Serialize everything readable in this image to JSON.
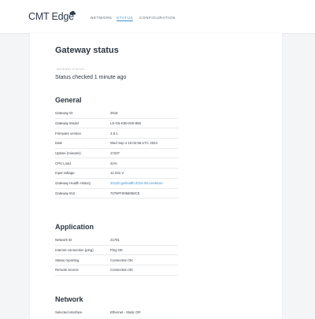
{
  "header": {
    "brand": "CMT Edge",
    "brand_icon": "cloud-icon",
    "nav": [
      {
        "label": "NETWORK"
      },
      {
        "label": "STATUS"
      },
      {
        "label": "CONFIGURATION"
      }
    ],
    "active_nav": "STATUS",
    "accent_color": "#3b8fd6"
  },
  "page": {
    "title": "Gateway status",
    "caption": "GATEWAY STATUS",
    "status_text": "Status checked 1 minute ago"
  },
  "general": {
    "title": "General",
    "rows": [
      {
        "key": "Gateway ID",
        "value": "2618"
      },
      {
        "key": "Gateway Model",
        "value": "LS-G6-K50-GW-868"
      },
      {
        "key": "Firmware version",
        "value": "2.9.1"
      },
      {
        "key": "Date",
        "value": "Wed Sep 4 10:02:56 UTC 2024"
      },
      {
        "key": "Uptime (minutes)",
        "value": "17237"
      },
      {
        "key": "CPU Load",
        "value": "41%"
      },
      {
        "key": "Input voltage",
        "value": "12.041 V"
      },
      {
        "key": "Gateway Health History",
        "value": "20120-gwhealth-2024-09.csv•More"
      },
      {
        "key": "Gateway EUI",
        "value": "7076FF0056050CE"
      }
    ]
  },
  "application": {
    "title": "Application",
    "rows": [
      {
        "key": "Network ID",
        "value": "21781"
      },
      {
        "key": "Internet connection (ping)",
        "value": "Ping OK"
      },
      {
        "key": "Status reporting",
        "value": "Connection OK"
      },
      {
        "key": "Remote access",
        "value": "Connection OK"
      }
    ]
  },
  "network": {
    "title": "Network",
    "rows": [
      {
        "key": "Selected interface",
        "value": "Ethernet - Static OR"
      }
    ]
  }
}
